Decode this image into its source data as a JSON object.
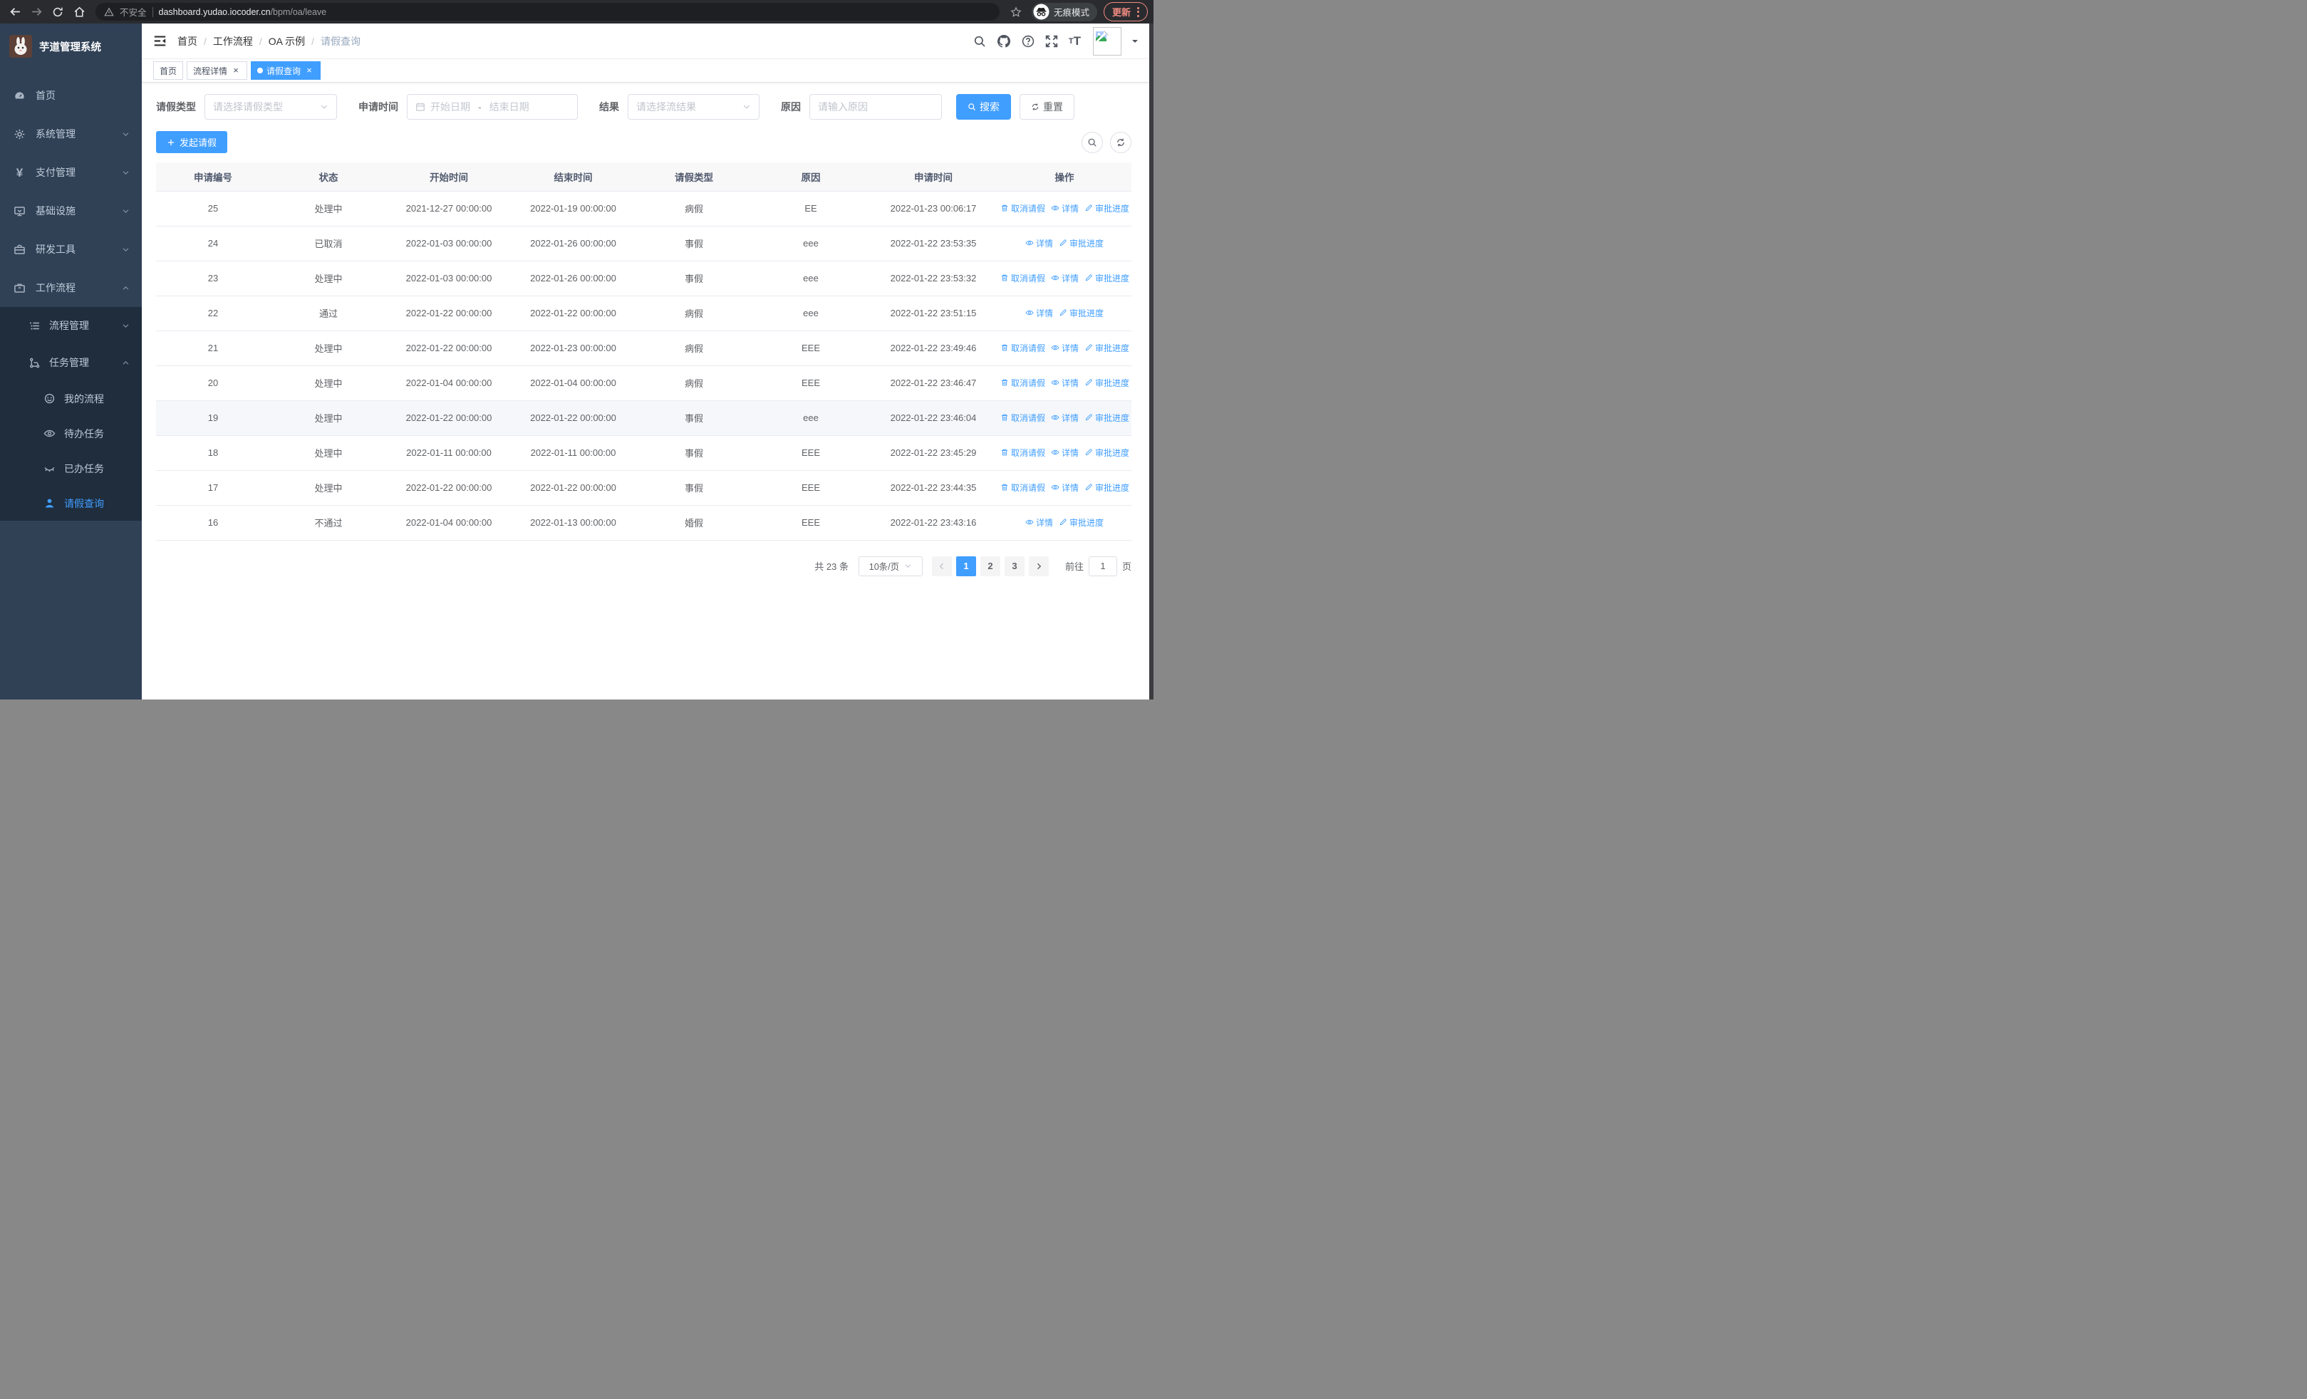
{
  "browser": {
    "security_label": "不安全",
    "url_domain": "dashboard.yudao.iocoder.cn",
    "url_path": "/bpm/oa/leave",
    "incognito_label": "无痕模式",
    "update_label": "更新"
  },
  "icons": {
    "close": "×",
    "yen": "¥",
    "font_small": "T",
    "font_large": "T"
  },
  "colors": {
    "primary": "#409eff",
    "sidebar_bg": "#304156",
    "submenu_bg": "#1f2d3d",
    "update_accent": "#f28b82"
  },
  "sidebar": {
    "title": "芋道管理系统",
    "items": [
      {
        "label": "首页"
      },
      {
        "label": "系统管理"
      },
      {
        "label": "支付管理"
      },
      {
        "label": "基础设施"
      },
      {
        "label": "研发工具"
      },
      {
        "label": "工作流程",
        "expanded": true
      }
    ],
    "submenu": [
      {
        "label": "流程管理"
      },
      {
        "label": "任务管理",
        "expanded": true
      }
    ],
    "tasks": [
      {
        "label": "我的流程"
      },
      {
        "label": "待办任务"
      },
      {
        "label": "已办任务"
      },
      {
        "label": "请假查询",
        "active": true
      }
    ]
  },
  "breadcrumb": [
    "首页",
    "工作流程",
    "OA 示例",
    "请假查询"
  ],
  "tabs": [
    {
      "label": "首页",
      "closable": false,
      "active": false
    },
    {
      "label": "流程详情",
      "closable": true,
      "active": false
    },
    {
      "label": "请假查询",
      "closable": true,
      "active": true
    }
  ],
  "filters": {
    "leave_type_label": "请假类型",
    "leave_type_placeholder": "请选择请假类型",
    "apply_time_label": "申请时间",
    "date_start_placeholder": "开始日期",
    "date_separator": "-",
    "date_end_placeholder": "结束日期",
    "result_label": "结果",
    "result_placeholder": "请选择流结果",
    "reason_label": "原因",
    "reason_placeholder": "请输入原因",
    "search_label": "搜索",
    "reset_label": "重置"
  },
  "toolbar": {
    "create_label": "发起请假"
  },
  "table": {
    "headers": [
      "申请编号",
      "状态",
      "开始时间",
      "结束时间",
      "请假类型",
      "原因",
      "申请时间",
      "操作"
    ],
    "action_labels": {
      "cancel": "取消请假",
      "detail": "详情",
      "progress": "审批进度"
    },
    "rows": [
      {
        "id": "25",
        "status": "处理中",
        "start": "2021-12-27 00:00:00",
        "end": "2022-01-19 00:00:00",
        "type": "病假",
        "reason": "EE",
        "applied": "2022-01-23 00:06:17",
        "cancellable": true,
        "highlighted": false
      },
      {
        "id": "24",
        "status": "已取消",
        "start": "2022-01-03 00:00:00",
        "end": "2022-01-26 00:00:00",
        "type": "事假",
        "reason": "eee",
        "applied": "2022-01-22 23:53:35",
        "cancellable": false,
        "highlighted": false
      },
      {
        "id": "23",
        "status": "处理中",
        "start": "2022-01-03 00:00:00",
        "end": "2022-01-26 00:00:00",
        "type": "事假",
        "reason": "eee",
        "applied": "2022-01-22 23:53:32",
        "cancellable": true,
        "highlighted": false
      },
      {
        "id": "22",
        "status": "通过",
        "start": "2022-01-22 00:00:00",
        "end": "2022-01-22 00:00:00",
        "type": "病假",
        "reason": "eee",
        "applied": "2022-01-22 23:51:15",
        "cancellable": false,
        "highlighted": false
      },
      {
        "id": "21",
        "status": "处理中",
        "start": "2022-01-22 00:00:00",
        "end": "2022-01-23 00:00:00",
        "type": "病假",
        "reason": "EEE",
        "applied": "2022-01-22 23:49:46",
        "cancellable": true,
        "highlighted": false
      },
      {
        "id": "20",
        "status": "处理中",
        "start": "2022-01-04 00:00:00",
        "end": "2022-01-04 00:00:00",
        "type": "病假",
        "reason": "EEE",
        "applied": "2022-01-22 23:46:47",
        "cancellable": true,
        "highlighted": false
      },
      {
        "id": "19",
        "status": "处理中",
        "start": "2022-01-22 00:00:00",
        "end": "2022-01-22 00:00:00",
        "type": "事假",
        "reason": "eee",
        "applied": "2022-01-22 23:46:04",
        "cancellable": true,
        "highlighted": true
      },
      {
        "id": "18",
        "status": "处理中",
        "start": "2022-01-11 00:00:00",
        "end": "2022-01-11 00:00:00",
        "type": "事假",
        "reason": "EEE",
        "applied": "2022-01-22 23:45:29",
        "cancellable": true,
        "highlighted": false
      },
      {
        "id": "17",
        "status": "处理中",
        "start": "2022-01-22 00:00:00",
        "end": "2022-01-22 00:00:00",
        "type": "事假",
        "reason": "EEE",
        "applied": "2022-01-22 23:44:35",
        "cancellable": true,
        "highlighted": false
      },
      {
        "id": "16",
        "status": "不通过",
        "start": "2022-01-04 00:00:00",
        "end": "2022-01-13 00:00:00",
        "type": "婚假",
        "reason": "EEE",
        "applied": "2022-01-22 23:43:16",
        "cancellable": false,
        "highlighted": false
      }
    ]
  },
  "pagination": {
    "total": "共 23 条",
    "page_size": "10条/页",
    "pages": [
      "1",
      "2",
      "3"
    ],
    "active_page": "1",
    "goto_label": "前往",
    "goto_value": "1",
    "page_unit": "页"
  }
}
